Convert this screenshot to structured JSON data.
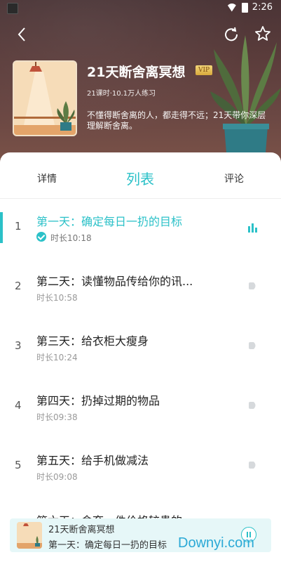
{
  "status_bar": {
    "time": "2:26"
  },
  "header": {
    "title": "21天断舍离冥想",
    "vip": "VIP",
    "meta": "21课时·10.1万人练习",
    "description": "不懂得断舍离的人，都走得不远；21天带你深层理解断舍离。"
  },
  "tabs": [
    "详情",
    "列表",
    "评论"
  ],
  "lessons": [
    {
      "num": "1",
      "title": "第一天：确定每日一扔的目标",
      "duration": "时长10:18",
      "active": true
    },
    {
      "num": "2",
      "title": "第二天：读懂物品传给你的讯...",
      "duration": "时长10:58",
      "active": false
    },
    {
      "num": "3",
      "title": "第三天：给衣柜大瘦身",
      "duration": "时长10:24",
      "active": false
    },
    {
      "num": "4",
      "title": "第四天：扔掉过期的物品",
      "duration": "时长09:38",
      "active": false
    },
    {
      "num": "5",
      "title": "第五天：给手机做减法",
      "duration": "时长09:08",
      "active": false
    }
  ],
  "cutoff_item": "第六天：舍弃一件价格较贵的",
  "mini_player": {
    "title": "21天断舍离冥想",
    "subtitle": "第一天：确定每日一扔的目标"
  },
  "watermark": "Downyi.com",
  "colors": {
    "accent": "#2bc1c8"
  }
}
